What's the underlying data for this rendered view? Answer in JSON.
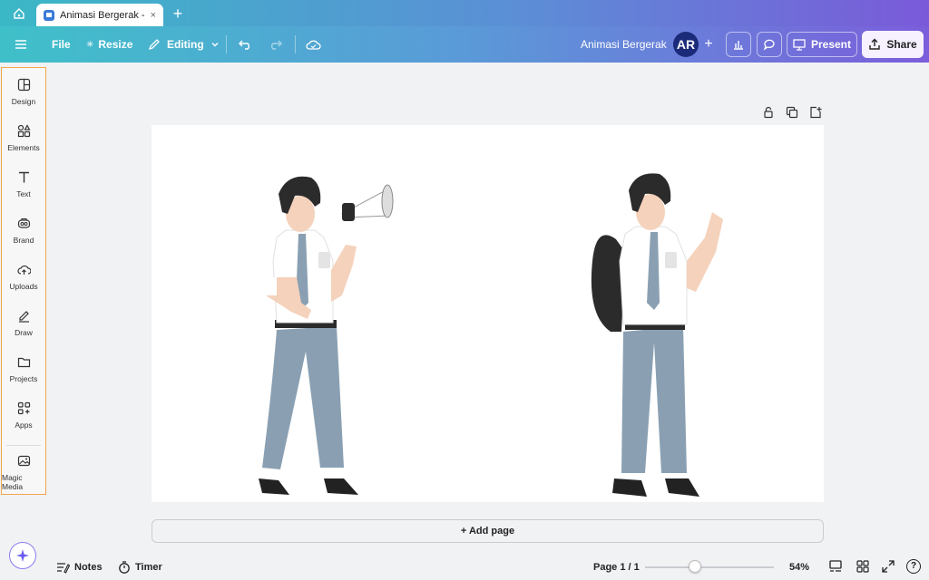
{
  "browser": {
    "tab_title": "Animasi Bergerak - ...",
    "tab_close": "×",
    "new_tab": "+"
  },
  "toolbar": {
    "file_label": "File",
    "resize_label": "Resize",
    "editing_label": "Editing",
    "design_title": "Animasi Bergerak",
    "avatar_initials": "AR",
    "add_label": "+",
    "present_label": "Present",
    "share_label": "Share"
  },
  "sidebar": {
    "items": [
      {
        "label": "Design",
        "icon": "design-icon"
      },
      {
        "label": "Elements",
        "icon": "elements-icon"
      },
      {
        "label": "Text",
        "icon": "text-icon"
      },
      {
        "label": "Brand",
        "icon": "brand-icon"
      },
      {
        "label": "Uploads",
        "icon": "uploads-icon"
      },
      {
        "label": "Draw",
        "icon": "draw-icon"
      },
      {
        "label": "Projects",
        "icon": "projects-icon"
      },
      {
        "label": "Apps",
        "icon": "apps-icon"
      },
      {
        "label": "Magic Media",
        "icon": "magic-media-icon"
      }
    ]
  },
  "canvas": {
    "add_page_label": "+ Add page"
  },
  "footer": {
    "notes_label": "Notes",
    "timer_label": "Timer",
    "page_indicator": "Page 1 / 1",
    "zoom_percent": "54%",
    "zoom_value": 54,
    "help_label": "?"
  },
  "colors": {
    "accent_purple": "#7b5edb",
    "accent_teal": "#3fc0c9",
    "sidebar_highlight": "#f2a54a"
  }
}
